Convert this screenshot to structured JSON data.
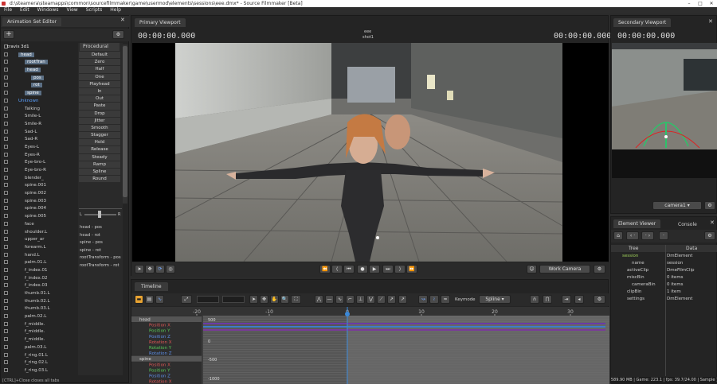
{
  "window": {
    "title": "d:\\steamera\\steamapps\\common\\sourcefilmmaker\\game\\usermod\\elements\\sessions\\eee.dmx* - Source Filmmaker [Beta]"
  },
  "menu": [
    "File",
    "Edit",
    "Windows",
    "View",
    "Scripts",
    "Help"
  ],
  "ase": {
    "title": "Animation Set Editor",
    "add": "+",
    "tree_left": [
      {
        "label": "travis 3d1",
        "cls": "root"
      },
      {
        "label": "head",
        "cls": "sel"
      },
      {
        "label": "rootTran",
        "cls": "sel"
      },
      {
        "label": "head",
        "cls": "sel"
      },
      {
        "label": "pos",
        "cls": "sel"
      },
      {
        "label": "rot",
        "cls": "sel"
      },
      {
        "label": "spine",
        "cls": "sel"
      },
      {
        "label": "Unknown",
        "cls": "blue"
      },
      {
        "label": "Talking",
        "cls": ""
      },
      {
        "label": "Smile-L",
        "cls": ""
      },
      {
        "label": "Smile-R",
        "cls": ""
      },
      {
        "label": "Sad-L",
        "cls": ""
      },
      {
        "label": "Sad-R",
        "cls": ""
      },
      {
        "label": "Eyes-L",
        "cls": ""
      },
      {
        "label": "Eyes-R",
        "cls": ""
      },
      {
        "label": "Eye-bro-L",
        "cls": ""
      },
      {
        "label": "Eye-bro-R",
        "cls": ""
      },
      {
        "label": "blender_",
        "cls": ""
      },
      {
        "label": "spine.001",
        "cls": ""
      },
      {
        "label": "spine.002",
        "cls": ""
      },
      {
        "label": "spine.003",
        "cls": ""
      },
      {
        "label": "spine.004",
        "cls": ""
      },
      {
        "label": "spine.005",
        "cls": ""
      },
      {
        "label": "face",
        "cls": ""
      },
      {
        "label": "shoulder.L",
        "cls": ""
      },
      {
        "label": "upper_ar",
        "cls": ""
      },
      {
        "label": "forearm.L",
        "cls": ""
      },
      {
        "label": "hand.L",
        "cls": ""
      },
      {
        "label": "palm.01.L",
        "cls": ""
      },
      {
        "label": "f_index.01",
        "cls": ""
      },
      {
        "label": "f_index.02",
        "cls": ""
      },
      {
        "label": "f_index.03",
        "cls": ""
      },
      {
        "label": "thumb.01.L",
        "cls": ""
      },
      {
        "label": "thumb.02.L",
        "cls": ""
      },
      {
        "label": "thumb.03.L",
        "cls": ""
      },
      {
        "label": "palm.02.L",
        "cls": ""
      },
      {
        "label": "f_middle.",
        "cls": ""
      },
      {
        "label": "f_middle.",
        "cls": ""
      },
      {
        "label": "f_middle.",
        "cls": ""
      },
      {
        "label": "palm.03.L",
        "cls": ""
      },
      {
        "label": "f_ring.01.L",
        "cls": ""
      },
      {
        "label": "f_ring.02.L",
        "cls": ""
      },
      {
        "label": "f_ring.03.L",
        "cls": ""
      },
      {
        "label": "palm.04.L",
        "cls": ""
      },
      {
        "label": "f_pinky.0",
        "cls": ""
      }
    ],
    "procedural_title": "Procedural",
    "procedural": [
      "Default",
      "Zero",
      "Half",
      "One",
      "Playhead",
      "In",
      "Out",
      "Paste",
      "Drop",
      "Jitter",
      "Smooth",
      "Stagger",
      "Hold",
      "Release",
      "Steady",
      "Ramp",
      "Spline",
      "Round"
    ],
    "slider_l": "L",
    "slider_r": "R",
    "selected_items": [
      "head - pos",
      "head - rot",
      "spine - pos",
      "spine - rot",
      "rootTransform - pos",
      "rootTransform - rot"
    ],
    "status": "[CTRL]+Close closes all tabs"
  },
  "primary": {
    "tab": "Primary Viewport",
    "tc_left": "00:00:00.000",
    "tc_right": "00:00:00.000",
    "clip_line1": "eee",
    "clip_line2": "shot1",
    "work_camera": "Work Camera"
  },
  "timeline": {
    "tab": "Timeline",
    "keymode_label": "Keymode",
    "keymode_value": "Spline",
    "ruler": [
      "-20",
      "-10",
      "0",
      "10",
      "20",
      "30"
    ],
    "yticks": [
      "500",
      "0",
      "-500",
      "-1000",
      "-1500"
    ],
    "channels": [
      {
        "label": "head",
        "cls": "grp"
      },
      {
        "label": "Position X",
        "cls": "r"
      },
      {
        "label": "Position Y",
        "cls": "g"
      },
      {
        "label": "Position Z",
        "cls": "b"
      },
      {
        "label": "Rotation X",
        "cls": "r"
      },
      {
        "label": "Rotation Y",
        "cls": "g"
      },
      {
        "label": "Rotation Z",
        "cls": "b"
      },
      {
        "label": "spine",
        "cls": "grp"
      },
      {
        "label": "Position X",
        "cls": "r"
      },
      {
        "label": "Position Y",
        "cls": "g"
      },
      {
        "label": "Position Z",
        "cls": "b"
      },
      {
        "label": "Rotation X",
        "cls": "r"
      }
    ]
  },
  "secondary": {
    "tab": "Secondary Viewport",
    "tc": "00:00:00.000",
    "camera": "camera1"
  },
  "element_viewer": {
    "tab1": "Element Viewer",
    "tab2": "Console",
    "col_tree": "Tree",
    "col_data": "Data",
    "rows": [
      {
        "tree": "session",
        "data": "DmElement"
      },
      {
        "tree": "name",
        "data": "session"
      },
      {
        "tree": "activeClip",
        "data": "DmeFilmClip"
      },
      {
        "tree": "miscBin",
        "data": "0 items"
      },
      {
        "tree": "cameraBin",
        "data": "0 items"
      },
      {
        "tree": "clipBin",
        "data": "1 item"
      },
      {
        "tree": "settings",
        "data": "DmElement"
      }
    ]
  },
  "statusbar": "[ Mem: 1589.90 MB | Game: 223.1 | fps: 39.7/24.00 | Sample"
}
